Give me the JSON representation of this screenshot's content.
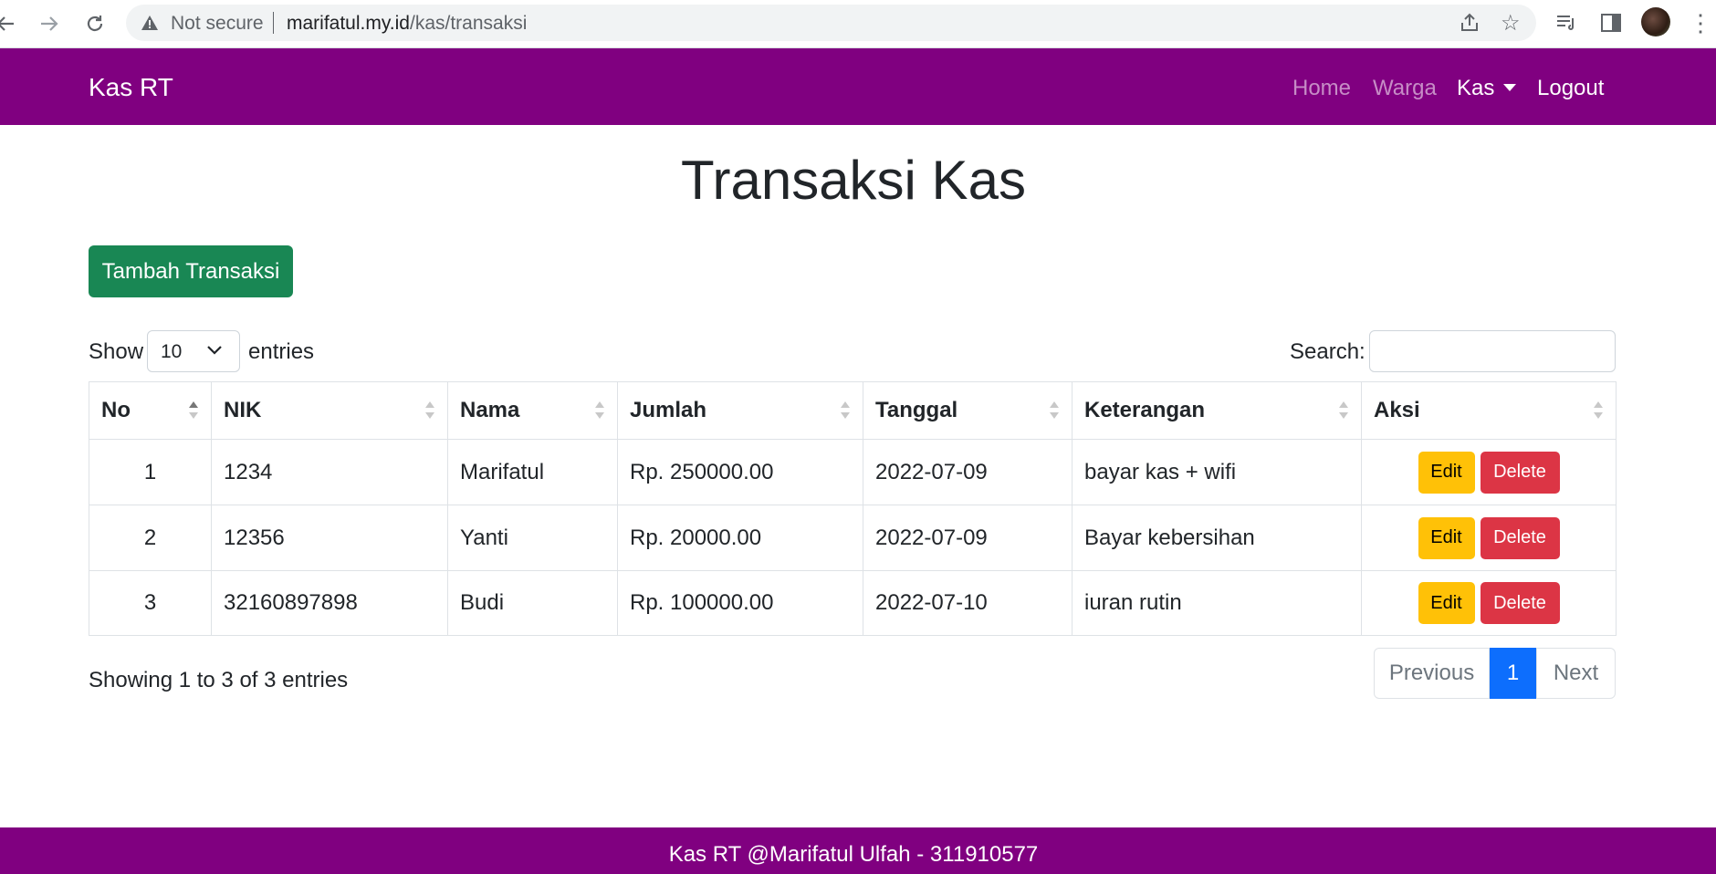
{
  "browser": {
    "security_text": "Not secure",
    "url_host": "marifatul.my.id",
    "url_path": "/kas/transaksi"
  },
  "navbar": {
    "brand": "Kas RT",
    "links": [
      {
        "label": "Home",
        "active": false
      },
      {
        "label": "Warga",
        "active": false
      },
      {
        "label": "Kas",
        "active": true,
        "dropdown": true
      },
      {
        "label": "Logout",
        "active": true
      }
    ],
    "color": "#800080"
  },
  "page": {
    "title": "Transaksi Kas",
    "add_button": "Tambah Transaksi"
  },
  "table_controls": {
    "show_label": "Show",
    "page_length": "10",
    "entries_label": "entries",
    "search_label": "Search:",
    "search_value": ""
  },
  "table": {
    "columns": [
      "No",
      "NIK",
      "Nama",
      "Jumlah",
      "Tanggal",
      "Keterangan",
      "Aksi"
    ],
    "rows": [
      {
        "no": "1",
        "nik": "1234",
        "nama": "Marifatul",
        "jumlah": "Rp. 250000.00",
        "tanggal": "2022-07-09",
        "keterangan": "bayar kas + wifi"
      },
      {
        "no": "2",
        "nik": "12356",
        "nama": "Yanti",
        "jumlah": "Rp. 20000.00",
        "tanggal": "2022-07-09",
        "keterangan": "Bayar kebersihan"
      },
      {
        "no": "3",
        "nik": "32160897898",
        "nama": "Budi",
        "jumlah": "Rp. 100000.00",
        "tanggal": "2022-07-10",
        "keterangan": "iuran rutin"
      }
    ],
    "edit_label": "Edit",
    "delete_label": "Delete"
  },
  "footer_info": {
    "showing": "Showing 1 to 3 of 3 entries"
  },
  "pagination": {
    "previous": "Previous",
    "current": "1",
    "next": "Next"
  },
  "footer": {
    "text": "Kas RT @Marifatul Ulfah - 311910577"
  },
  "colors": {
    "add_button": "#198754",
    "edit_button": "#ffc107",
    "delete_button": "#dc3545",
    "page_active": "#0d6efd"
  }
}
